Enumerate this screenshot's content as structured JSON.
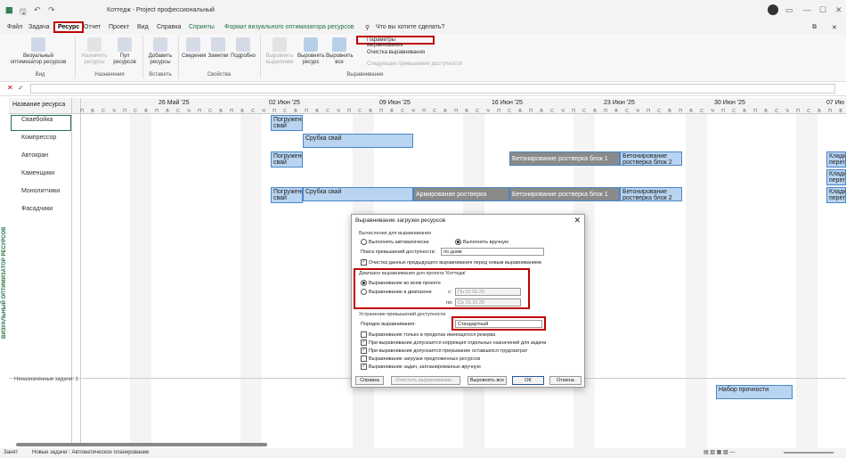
{
  "window": {
    "title": "Коттедж - Project профессиональный"
  },
  "search": {
    "placeholder": "Что вы хотите сделать?"
  },
  "tabs": [
    "Файл",
    "Задача",
    "Ресурс",
    "Отчет",
    "Проект",
    "Вид",
    "Справка",
    "Спринты",
    "Формат визуального оптимизатора ресурсов"
  ],
  "ribbon": {
    "vis_opt": "Визуальный оптимизатор ресурсов",
    "assign_res": "Назначить ресурсы",
    "pool": "Пул ресурсов",
    "add_res": "Добавить ресурсы",
    "info": "Сведения",
    "notes": "Заметки",
    "details": "Подробно",
    "level_sel": "Выровнять выделение",
    "level_res": "Выровнять ресурс",
    "level_all": "Выровнять все",
    "level_opts": "Параметры выравнивания",
    "clear_level": "Очистка выравнивания",
    "next_overalloc": "Следующее превышение доступности",
    "groups": {
      "view": "Вид",
      "assignments": "Назначения",
      "insert": "Вставить",
      "props": "Свойства",
      "leveling": "Выравнивание"
    }
  },
  "grid": {
    "col_header": "Название ресурса",
    "weeks": [
      "26 Май '25",
      "02 Июн '25",
      "09 Июн '25",
      "16 Июн '25",
      "23 Июн '25",
      "30 Июн '25",
      "07 Ию"
    ],
    "resources": [
      "Сваебойка",
      "Компрессор",
      "Автокран",
      "Каменщики",
      "Монолитчики",
      "Фасадчики"
    ],
    "unassigned": "Неназначенные задачи: 1",
    "side_label": "ВИЗУАЛЬНЫЙ ОПТИМИЗАТОР РЕСУРСОВ",
    "tasks": {
      "pogr": "Погружение свай",
      "rubka": "Срубка свай",
      "beton1": "Бетонирование ростверка блок 1",
      "beton2": "Бетонирование ростверка блок 2",
      "armir": "Армирование ростверка",
      "klad": "Кладка перегр",
      "nabor": "Набор прочности"
    }
  },
  "dialog": {
    "title": "Выравнивание загрузки ресурсов",
    "calc": "Вычисления для выравнивания",
    "auto": "Выполнять автоматически",
    "manual": "Выполнять вручную",
    "search": "Поиск превышений доступности:",
    "search_val": "по дням",
    "clear": "Очистка данных предыдущего выравнивания перед новым выравниванием",
    "range": "Диапазон выравнивания для проекта 'Коттедж'",
    "whole": "Выравнивание во всем проекте",
    "inrange": "Выравнивание в диапазоне",
    "from": "с:",
    "from_val": "Пн 02.06.25",
    "to": "по:",
    "to_val": "Ср 15.10.25",
    "resolve": "Устранение превышений доступности",
    "order": "Порядок выравнивания:",
    "order_val": "Стандартный",
    "opts": [
      "Выравнивание только в пределах имеющегося резерва",
      "При выравнивании допускается коррекция отдельных назначений для задачи",
      "При выравнивании допускается прерывание оставшихся трудозатрат",
      "Выравнивание загрузки предложенных ресурсов",
      "Выравнивание задач, запланированных вручную"
    ],
    "btn_help": "Справка",
    "btn_clear": "Очистить выравнивание...",
    "btn_all": "Выровнять все",
    "btn_ok": "ОК",
    "btn_cancel": "Отмена"
  },
  "status": {
    "ready": "Занят",
    "new_tasks": "Новые задачи : Автоматическое планирование"
  }
}
